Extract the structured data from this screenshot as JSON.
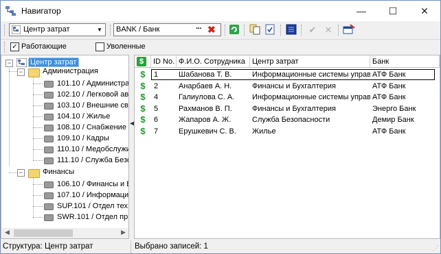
{
  "window": {
    "title": "Навигатор",
    "min_glyph": "—",
    "max_glyph": "☐",
    "close_glyph": "✕"
  },
  "toolbar": {
    "structure_combo": "Центр затрат",
    "bank_field": "BANK / Банк",
    "bank_dots": "···",
    "bank_clear": "✖",
    "icons": [
      "refresh-icon",
      "copy-icon",
      "check-doc-icon",
      "list-icon",
      "checkmark-icon",
      "delete-icon",
      "export-icon"
    ]
  },
  "filters": {
    "working": {
      "label": "Работающие",
      "checked": true
    },
    "fired": {
      "label": "Уволенные",
      "checked": false
    }
  },
  "tree": {
    "root": "Центр затрат",
    "groups": [
      {
        "label": "Администрация",
        "items": [
          "101.10 / Администра",
          "102.10 / Легковой ав",
          "103.10 / Внешние свя",
          "104.10 / Жилье",
          "108.10 / Снабжение",
          "109.10 / Кадры",
          "110.10 / Медобслужи",
          "111.10 / Служба Безо"
        ]
      },
      {
        "label": "Финансы",
        "items": [
          "106.10 / Финансы и Б",
          "107.10 / Информацио",
          "SUP.101 / Отдел тех",
          "SWR.101 / Отдел пр"
        ]
      }
    ]
  },
  "grid": {
    "headers": {
      "dollar": "$",
      "id": "ID No.",
      "name": "Ф.И.О. Сотрудника",
      "center": "Центр затрат",
      "bank": "Банк"
    },
    "rows": [
      {
        "id": "1",
        "name": "Шабанова Т. В.",
        "center": "Информационные системы управл",
        "bank": "АТФ Банк"
      },
      {
        "id": "2",
        "name": "Анарбаев А. Н.",
        "center": "Финансы и Бухгалтерия",
        "bank": "АТФ Банк"
      },
      {
        "id": "4",
        "name": "Галиулова С. А.",
        "center": "Информационные системы управл",
        "bank": "АТФ Банк"
      },
      {
        "id": "5",
        "name": "Рахманов В. П.",
        "center": "Финансы и Бухгалтерия",
        "bank": "Энерго Банк"
      },
      {
        "id": "6",
        "name": "Жапаров А. Ж.",
        "center": "Служба Безопасности",
        "bank": "Демир Банк"
      },
      {
        "id": "7",
        "name": "Ерушкевич С. В.",
        "center": "Жилье",
        "bank": "АТФ Банк"
      }
    ],
    "selected_row": "1"
  },
  "status": {
    "left": "Структура: Центр затрат",
    "right": "Выбрано записей: 1"
  }
}
